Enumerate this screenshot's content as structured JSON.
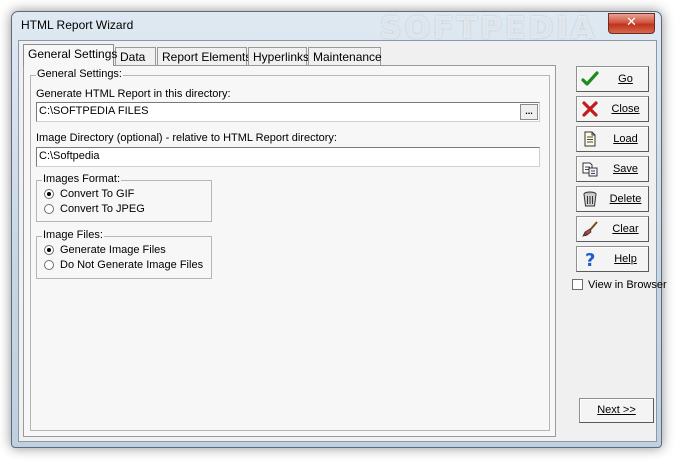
{
  "window": {
    "title": "HTML Report Wizard",
    "watermark": "SOFTPEDIA",
    "close_glyph": "✕"
  },
  "tabs": [
    {
      "label": "General Settings",
      "active": true
    },
    {
      "label": "Data"
    },
    {
      "label": "Report Elements"
    },
    {
      "label": "Hyperlinks"
    },
    {
      "label": "Maintenance"
    }
  ],
  "general": {
    "group_label": "General Settings:",
    "report_dir_label": "Generate HTML Report in this directory:",
    "report_dir_value": "C:\\SOFTPEDIA FILES",
    "browse_label": "...",
    "image_dir_label": "Image Directory (optional) - relative to HTML Report directory:",
    "image_dir_value": "C:\\Softpedia",
    "images_format": {
      "label": "Images Format:",
      "options": [
        "Convert To GIF",
        "Convert To JPEG"
      ],
      "selected": "Convert To GIF"
    },
    "image_files": {
      "label": "Image Files:",
      "options": [
        "Generate Image Files",
        "Do Not Generate Image Files"
      ],
      "selected": "Generate Image Files"
    }
  },
  "sidebar": {
    "buttons": [
      {
        "label": "Go",
        "icon": "green-check-icon"
      },
      {
        "label": "Close",
        "icon": "red-x-icon"
      },
      {
        "label": "Load",
        "icon": "document-load-icon"
      },
      {
        "label": "Save",
        "icon": "save-document-icon"
      },
      {
        "label": "Delete",
        "icon": "trash-can-icon"
      },
      {
        "label": "Clear",
        "icon": "broom-icon"
      },
      {
        "label": "Help",
        "icon": "question-mark-icon"
      }
    ],
    "view_in_browser_label": "View in Browser",
    "view_in_browser_checked": false
  },
  "footer": {
    "next_label": "Next >>"
  },
  "colors": {
    "check_green": "#1e8a1e",
    "x_red": "#c41a1a",
    "help_blue": "#1c5fc8"
  }
}
